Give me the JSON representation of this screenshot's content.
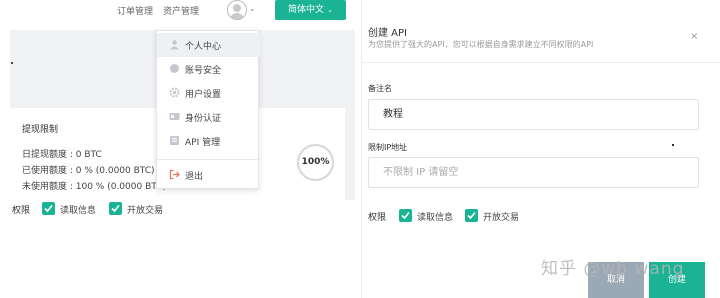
{
  "left": {
    "nav": {
      "orders": "订单管理",
      "assets": "资产管理",
      "language": "简体中文"
    },
    "menu": {
      "items": [
        {
          "label": "个人中心",
          "icon": "user-icon"
        },
        {
          "label": "账号安全",
          "icon": "shield-icon"
        },
        {
          "label": "用户设置",
          "icon": "gear-icon"
        },
        {
          "label": "身份认证",
          "icon": "id-card-icon"
        },
        {
          "label": "API 管理",
          "icon": "api-icon"
        },
        {
          "label": "退出",
          "icon": "logout-icon"
        }
      ]
    },
    "limits": {
      "title": "提现限制",
      "daily_limit": "日提现额度 : 0 BTC",
      "used": "已使用额度 : 0 % (0.0000 BTC)",
      "unused": "未使用额度 : 100 % (0.0000 BTC)",
      "percent": "100%",
      "percent_value": 100
    },
    "permissions": {
      "label": "权限",
      "read": "读取信息",
      "trade": "开放交易"
    }
  },
  "modal": {
    "title": "创建 API",
    "subtitle": "为您提供了强大的API，您可以根据自身需求建立不同权限的API",
    "close": "×",
    "note_label": "备注名",
    "note_value": "教程",
    "ip_label": "限制IP地址",
    "ip_placeholder": "不限制 IP 请留空",
    "permissions": {
      "label": "权限",
      "read": "读取信息",
      "trade": "开放交易"
    },
    "cancel": "取消",
    "create": "创建"
  },
  "watermark": "知乎 @wb wang",
  "colors": {
    "accent": "#1ab394",
    "cancel": "#9ba8b6"
  }
}
